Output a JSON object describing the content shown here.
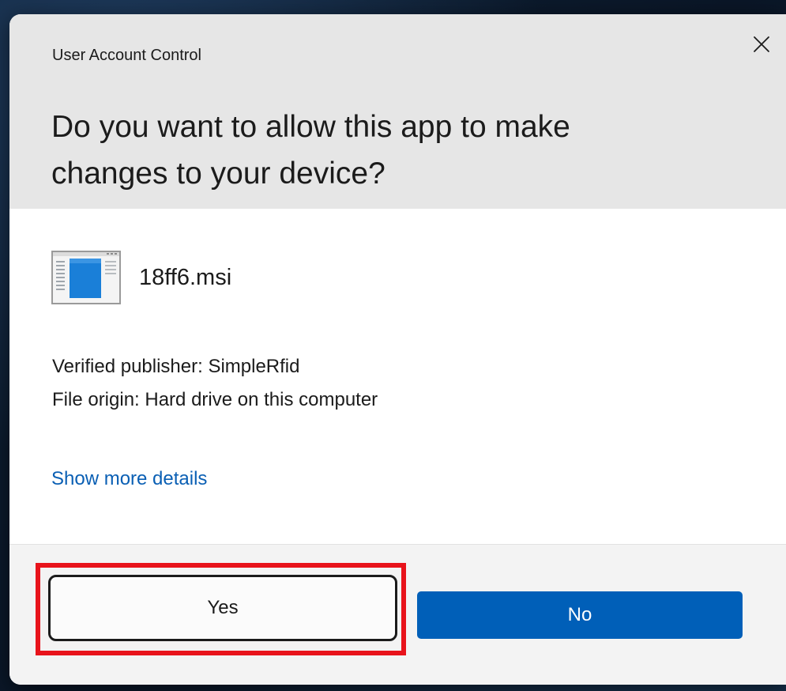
{
  "dialog": {
    "window_title": "User Account Control",
    "question_line1": "Do you want to allow this app to make",
    "question_line2": "changes to your device?",
    "close_icon": "close-icon"
  },
  "app": {
    "icon": "installer-window-icon",
    "name": "18ff6.msi"
  },
  "info": {
    "publisher": "Verified publisher: SimpleRfid",
    "origin": "File origin: Hard drive on this computer"
  },
  "links": {
    "show_more_details": "Show more details"
  },
  "buttons": {
    "yes_label": "Yes",
    "no_label": "No"
  },
  "colors": {
    "accent": "#005fb8",
    "link": "#0a5fb4",
    "highlight": "#e8131b",
    "header_bg": "#e6e6e6",
    "footer_bg": "#f3f3f3"
  }
}
